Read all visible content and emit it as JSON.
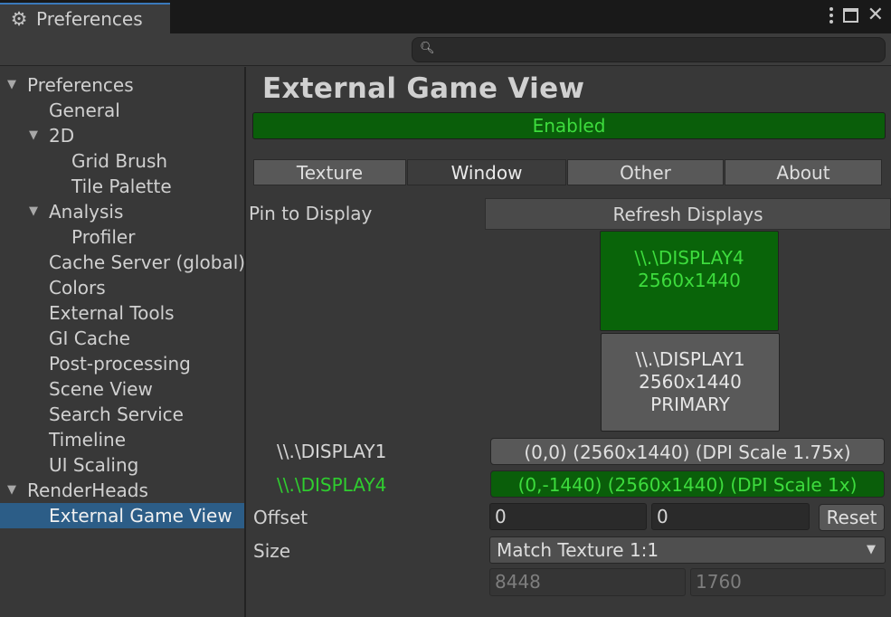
{
  "window": {
    "tab_title": "Preferences",
    "tab_icon": "gear-icon"
  },
  "search": {
    "placeholder": "",
    "value": ""
  },
  "sidebar": {
    "items": [
      {
        "label": "Preferences",
        "expanded": true
      },
      {
        "label": "General"
      },
      {
        "label": "2D",
        "expanded": true
      },
      {
        "label": "Grid Brush"
      },
      {
        "label": "Tile Palette"
      },
      {
        "label": "Analysis",
        "expanded": true
      },
      {
        "label": "Profiler"
      },
      {
        "label": "Cache Server (global)"
      },
      {
        "label": "Colors"
      },
      {
        "label": "External Tools"
      },
      {
        "label": "GI Cache"
      },
      {
        "label": "Post-processing"
      },
      {
        "label": "Scene View"
      },
      {
        "label": "Search Service"
      },
      {
        "label": "Timeline"
      },
      {
        "label": "UI Scaling"
      },
      {
        "label": "RenderHeads",
        "expanded": true
      },
      {
        "label": "External Game View",
        "selected": true
      }
    ]
  },
  "main": {
    "title": "External Game View",
    "enabled_label": "Enabled",
    "tabs": [
      {
        "label": "Texture"
      },
      {
        "label": "Window",
        "active": true
      },
      {
        "label": "Other"
      },
      {
        "label": "About"
      }
    ],
    "pin_label": "Pin to Display",
    "refresh_label": "Refresh Displays",
    "display_boxes": {
      "display4": {
        "line1": "\\\\.\\DISPLAY4",
        "line2": "2560x1440"
      },
      "display1": {
        "line1": "\\\\.\\DISPLAY1",
        "line2": "2560x1440",
        "line3": "PRIMARY"
      }
    },
    "displays": [
      {
        "name": "\\\\.\\DISPLAY1",
        "info": "(0,0) (2560x1440) (DPI Scale 1.75x)"
      },
      {
        "name": "\\\\.\\DISPLAY4",
        "info": "(0,-1440) (2560x1440) (DPI Scale 1x)"
      }
    ],
    "offset_label": "Offset",
    "offset_x": "0",
    "offset_y": "0",
    "reset_label": "Reset",
    "size_label": "Size",
    "size_value": "Match Texture 1:1",
    "size_width": "8448",
    "size_height": "1760"
  },
  "colors": {
    "accent_green_bg": "#0a5e0a",
    "accent_green_text": "#3ddc3d",
    "selection": "#2c5d87"
  }
}
